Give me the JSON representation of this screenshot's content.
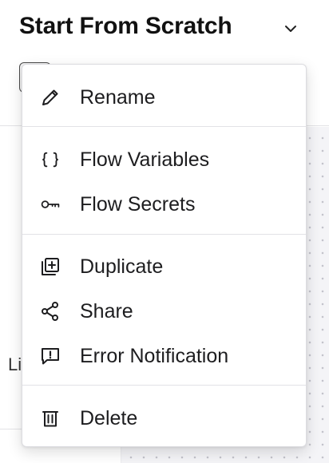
{
  "header": {
    "title": "Start From Scratch"
  },
  "left_panel": {
    "partial_label": "Li"
  },
  "menu": {
    "items": [
      {
        "label": "Rename",
        "icon": "pencil-icon"
      },
      {
        "label": "Flow Variables",
        "icon": "curly-braces-icon"
      },
      {
        "label": "Flow Secrets",
        "icon": "key-icon"
      },
      {
        "label": "Duplicate",
        "icon": "duplicate-icon"
      },
      {
        "label": "Share",
        "icon": "share-icon"
      },
      {
        "label": "Error Notification",
        "icon": "error-notification-icon"
      },
      {
        "label": "Delete",
        "icon": "trash-icon"
      }
    ]
  },
  "colors": {
    "text": "#1d1d1f",
    "separator": "#e2e2e6",
    "canvas": "#f4f4f7"
  }
}
